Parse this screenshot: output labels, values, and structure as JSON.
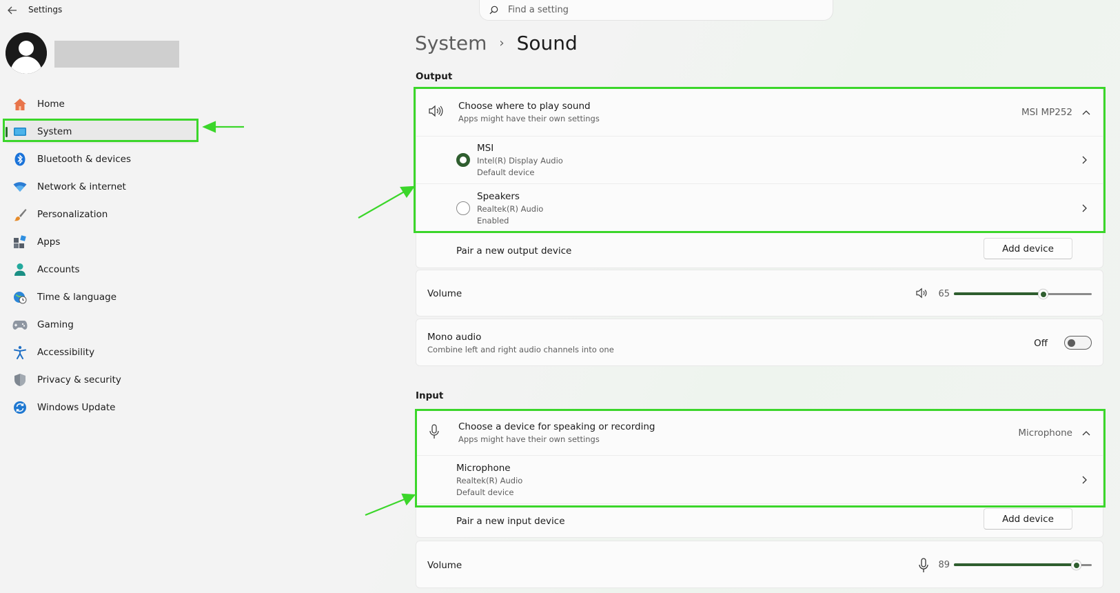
{
  "app": {
    "title": "Settings",
    "back_label": "Back"
  },
  "search": {
    "placeholder": "Find a setting"
  },
  "sidebar": {
    "items": [
      {
        "label": "Home",
        "icon": "home-icon"
      },
      {
        "label": "System",
        "icon": "monitor-icon",
        "selected": true
      },
      {
        "label": "Bluetooth & devices",
        "icon": "bluetooth-icon"
      },
      {
        "label": "Network & internet",
        "icon": "wifi-icon"
      },
      {
        "label": "Personalization",
        "icon": "paintbrush-icon"
      },
      {
        "label": "Apps",
        "icon": "apps-icon"
      },
      {
        "label": "Accounts",
        "icon": "person-icon"
      },
      {
        "label": "Time & language",
        "icon": "globe-clock-icon"
      },
      {
        "label": "Gaming",
        "icon": "gamepad-icon"
      },
      {
        "label": "Accessibility",
        "icon": "accessibility-icon"
      },
      {
        "label": "Privacy & security",
        "icon": "shield-icon"
      },
      {
        "label": "Windows Update",
        "icon": "refresh-icon"
      }
    ]
  },
  "breadcrumb": {
    "parent": "System",
    "separator": "›",
    "current": "Sound"
  },
  "output": {
    "section_label": "Output",
    "chooser": {
      "title": "Choose where to play sound",
      "subtitle": "Apps might have their own settings",
      "current_value": "MSI MP252"
    },
    "devices": [
      {
        "name": "MSI",
        "line1": "Intel(R) Display Audio",
        "line2": "Default device",
        "selected": true
      },
      {
        "name": "Speakers",
        "line1": "Realtek(R) Audio",
        "line2": "Enabled",
        "selected": false
      }
    ],
    "pair": {
      "label": "Pair a new output device",
      "button": "Add device"
    },
    "volume": {
      "label": "Volume",
      "value": "65",
      "level": 0.65
    },
    "mono": {
      "title": "Mono audio",
      "subtitle": "Combine left and right audio channels into one",
      "state": "Off"
    }
  },
  "input": {
    "section_label": "Input",
    "chooser": {
      "title": "Choose a device for speaking or recording",
      "subtitle": "Apps might have their own settings",
      "current_value": "Microphone"
    },
    "devices": [
      {
        "name": "Microphone",
        "line1": "Realtek(R) Audio",
        "line2": "Default device"
      }
    ],
    "pair": {
      "label": "Pair a new input device",
      "button": "Add device"
    },
    "volume": {
      "label": "Volume",
      "value": "89",
      "level": 0.89
    }
  },
  "colors": {
    "accent": "#2f5e2f",
    "annotation": "#3bd62a"
  }
}
